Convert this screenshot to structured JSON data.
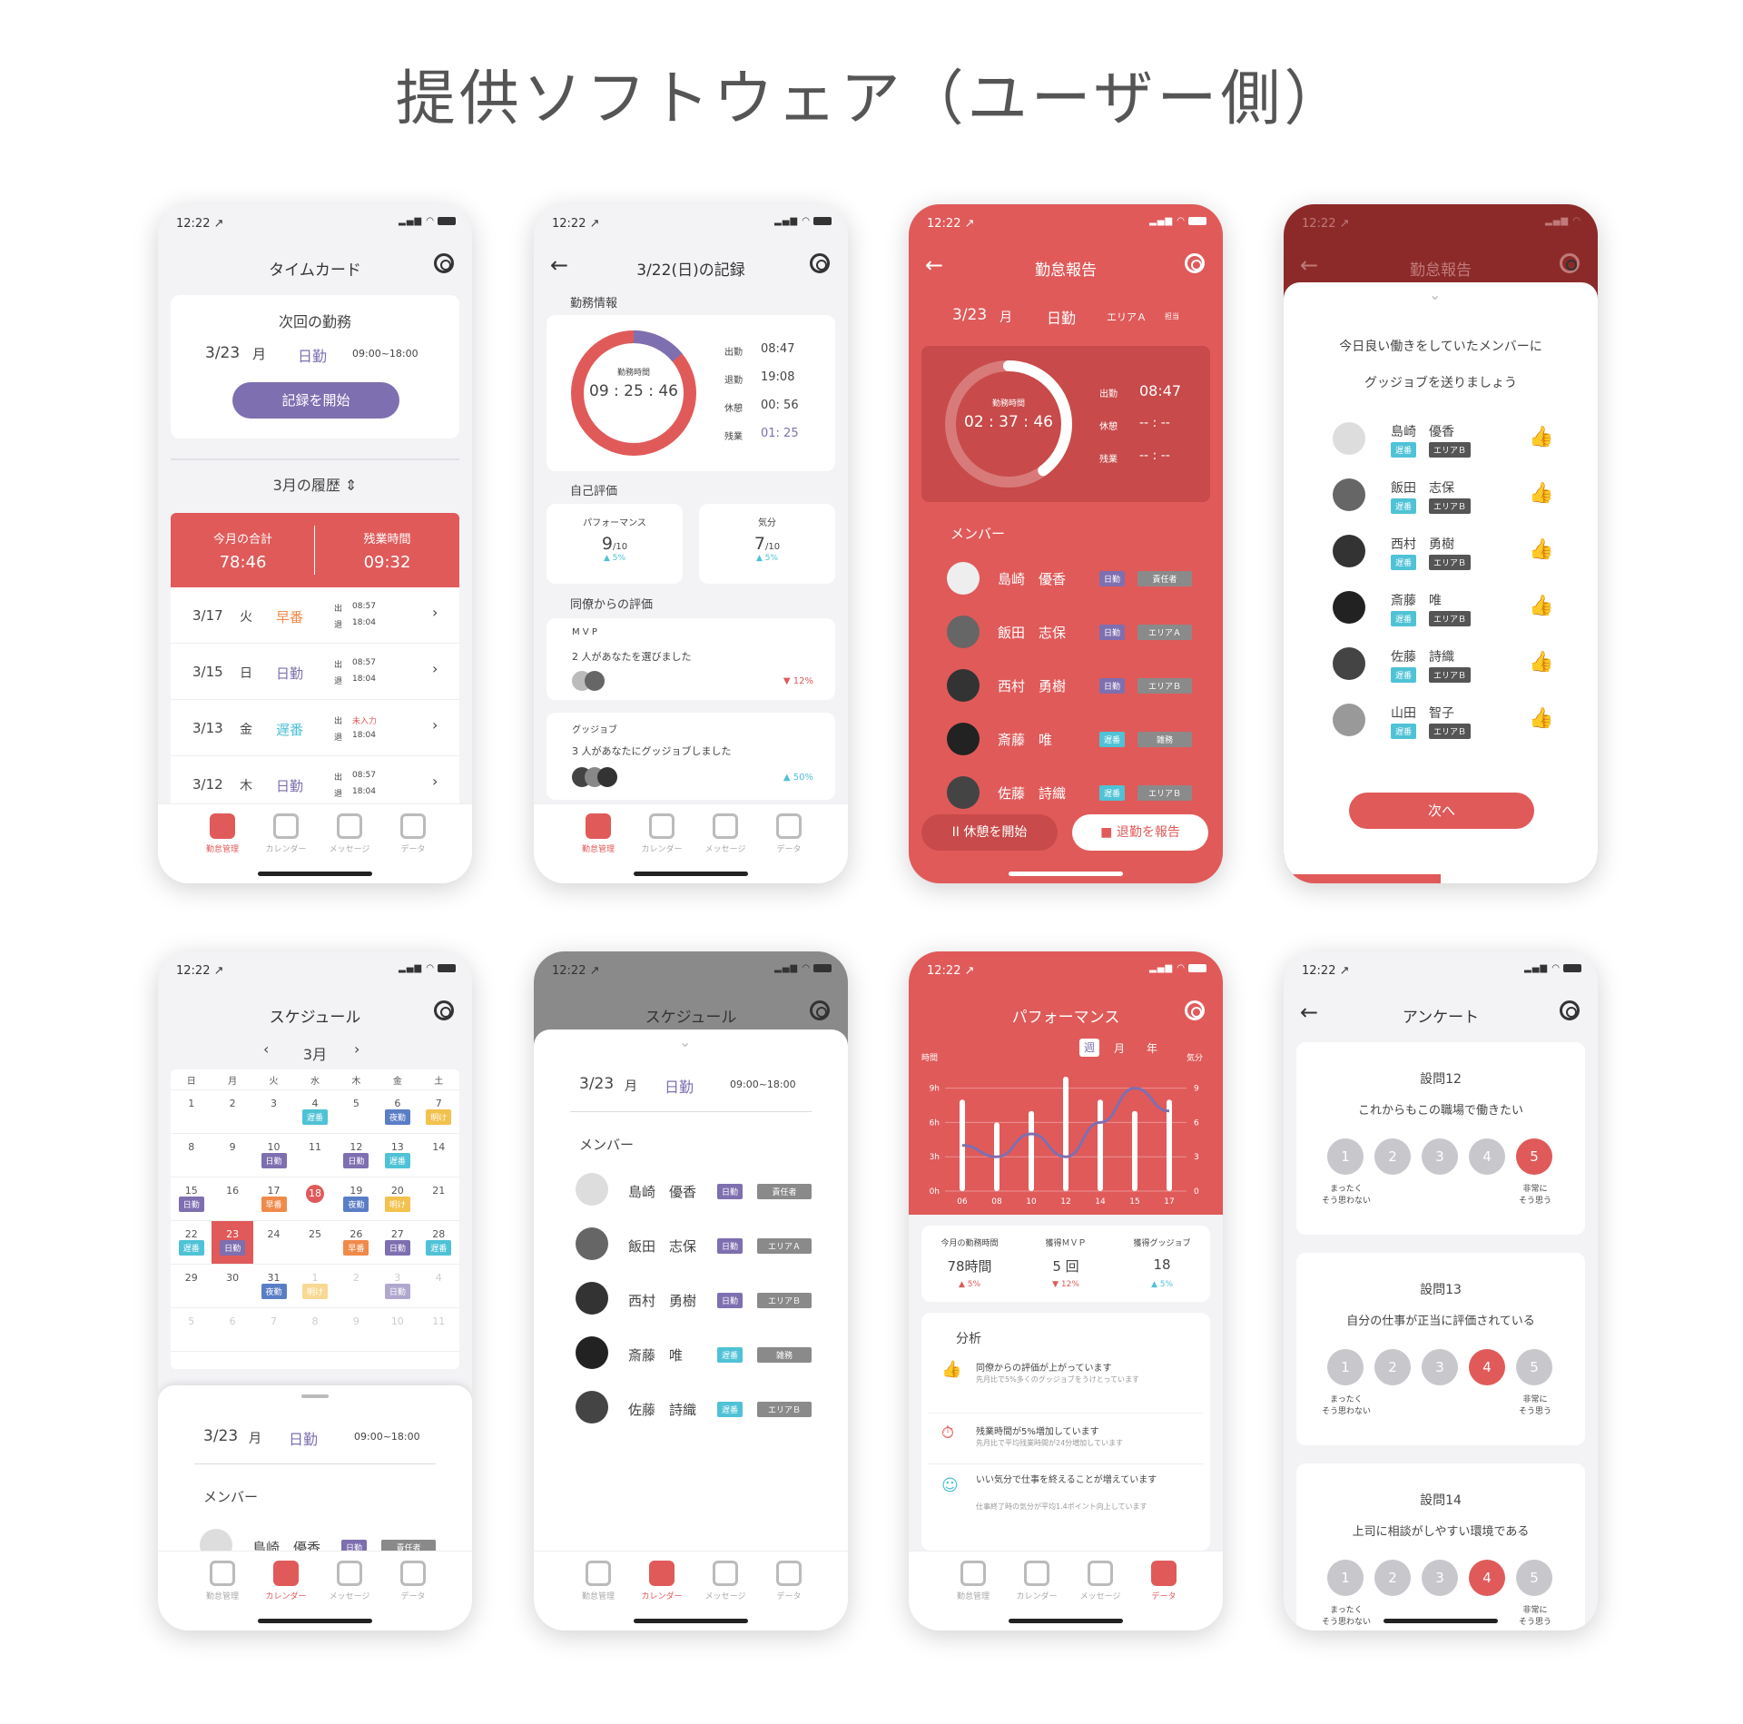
{
  "page_title": "提供ソフトウェア（ユーザー側）",
  "status": {
    "time": "12:22 ↗"
  },
  "tabs": [
    "勤怠管理",
    "カレンダー",
    "メッセージ",
    "データ"
  ],
  "s1": {
    "title": "タイムカード",
    "next_label": "次回の勤務",
    "next_date": "3/23",
    "next_dow": "月",
    "next_shift": "日勤",
    "next_time": "09:00~18:00",
    "start_btn": "記録を開始",
    "history": "3月の履歴 ⇕",
    "total_label": "今月の合計",
    "total": "78:46",
    "ot_label": "残業時間",
    "ot": "09:32",
    "rows": [
      {
        "date": "3/17",
        "dow": "火",
        "shift": "早番",
        "in": "08:57",
        "out": "18:04"
      },
      {
        "date": "3/15",
        "dow": "日",
        "shift": "日勤",
        "in": "08:57",
        "out": "18:04"
      },
      {
        "date": "3/13",
        "dow": "金",
        "shift": "遅番",
        "in": "未入力",
        "out": "18:04"
      },
      {
        "date": "3/12",
        "dow": "木",
        "shift": "日勤",
        "in": "08:57",
        "out": "18:04"
      }
    ],
    "in_label": "出",
    "out_label": "退"
  },
  "s2": {
    "title": "3/22(日)の記録",
    "work_info": "勤務情報",
    "ring_label": "勤務時間",
    "ring_value": "09 : 25 : 46",
    "stats": [
      [
        "出勤",
        "08:47"
      ],
      [
        "退勤",
        "19:08"
      ],
      [
        "休憩",
        "00: 56"
      ],
      [
        "残業",
        "01: 25"
      ]
    ],
    "self_eval": "自己評価",
    "perf_label": "パフォーマンス",
    "perf": "9",
    "perf_unit": "/10",
    "perf_delta": "▲ 5%",
    "mood_label": "気分",
    "mood": "7",
    "mood_unit": "/10",
    "mood_delta": "▲ 5%",
    "peer_eval": "同僚からの評価",
    "mvp_label": "M V P",
    "mvp_text": "2 人があなたを選びました",
    "mvp_delta": "▼ 12%",
    "gj_label": "グッジョブ",
    "gj_text": "3 人があなたにグッジョブしました",
    "gj_delta": "▲ 50%"
  },
  "s3": {
    "title": "勤怠報告",
    "date": "3/23",
    "dow": "月",
    "shift": "日勤",
    "area": "エリアＡ",
    "role": "担当",
    "ring_label": "勤務時間",
    "ring_value": "02 : 37 : 46",
    "stats": [
      [
        "出勤",
        "08:47"
      ],
      [
        "休憩",
        "-- : --"
      ],
      [
        "残業",
        "-- : --"
      ]
    ],
    "members_label": "メンバー",
    "members": [
      {
        "name": "島崎　優香",
        "shift": "日勤",
        "tag": "責任者"
      },
      {
        "name": "飯田　志保",
        "shift": "日勤",
        "tag": "エリアＡ"
      },
      {
        "name": "西村　勇樹",
        "shift": "日勤",
        "tag": "エリアＢ"
      },
      {
        "name": "斎藤　唯",
        "shift": "遅番",
        "tag": "雑務"
      },
      {
        "name": "佐藤　詩織",
        "shift": "遅番",
        "tag": "エリアＢ"
      }
    ],
    "break_btn": "II  休憩を開始",
    "leave_btn": "■  退勤を報告"
  },
  "s4": {
    "title": "勤怠報告",
    "line1": "今日良い働きをしていたメンバーに",
    "line2": "グッジョブを送りましょう",
    "members": [
      {
        "name": "島崎　優香",
        "shift": "遅番",
        "area": "エリアＢ",
        "liked": true
      },
      {
        "name": "飯田　志保",
        "shift": "遅番",
        "area": "エリアＢ",
        "liked": true
      },
      {
        "name": "西村　勇樹",
        "shift": "遅番",
        "area": "エリアＢ",
        "liked": false
      },
      {
        "name": "斎藤　唯",
        "shift": "遅番",
        "area": "エリアＢ",
        "liked": false
      },
      {
        "name": "佐藤　詩織",
        "shift": "遅番",
        "area": "エリアＢ",
        "liked": true
      },
      {
        "name": "山田　智子",
        "shift": "遅番",
        "area": "エリアＢ",
        "liked": false
      }
    ],
    "next_btn": "次へ"
  },
  "s5": {
    "title": "スケジュール",
    "month": "3月",
    "dows": [
      "日",
      "月",
      "火",
      "水",
      "木",
      "金",
      "土"
    ],
    "sheet_date": "3/23",
    "sheet_dow": "月",
    "sheet_shift": "日勤",
    "sheet_time": "09:00~18:00",
    "members_label": "メンバー",
    "first_member": "島崎　優香",
    "first_shift": "日勤",
    "first_tag": "責任者"
  },
  "s6": {
    "title": "スケジュール",
    "date": "3/23",
    "dow": "月",
    "shift": "日勤",
    "time": "09:00~18:00",
    "members_label": "メンバー",
    "members": [
      {
        "name": "島崎　優香",
        "shift": "日勤",
        "tag": "責任者"
      },
      {
        "name": "飯田　志保",
        "shift": "日勤",
        "tag": "エリアＡ"
      },
      {
        "name": "西村　勇樹",
        "shift": "日勤",
        "tag": "エリアＢ"
      },
      {
        "name": "斎藤　唯",
        "shift": "遅番",
        "tag": "雑務"
      },
      {
        "name": "佐藤　詩織",
        "shift": "遅番",
        "tag": "エリアＢ"
      }
    ]
  },
  "s7": {
    "title": "パフォーマンス",
    "periods": [
      "週",
      "月",
      "年"
    ],
    "y_left_label": "時間",
    "y_right_label": "気分",
    "kpi": [
      {
        "label": "今月の勤務時間",
        "value": "78時間",
        "delta": "▲ 5%"
      },
      {
        "label": "獲得ＭＶＰ",
        "value": "5 回",
        "delta": "▼ 12%"
      },
      {
        "label": "獲得グッジョブ",
        "value": "18",
        "delta": "▲ 5%"
      }
    ],
    "analysis_title": "分析",
    "analysis": [
      {
        "head": "同僚からの評価が上がっています",
        "body": "先月比で5%多くのグッジョブをうけとっています"
      },
      {
        "head": "残業時間が5%増加しています",
        "body": "先月比で平均残業時間が24分増加しています"
      },
      {
        "head": "いい気分で仕事を終えることが増えています",
        "body": "仕事終了時の気分が平均1.4ポイント向上しています"
      }
    ]
  },
  "chart_data": {
    "type": "bar",
    "categories": [
      "06",
      "08",
      "10",
      "12",
      "14",
      "15",
      "17"
    ],
    "series": [
      {
        "values": [
          8,
          6,
          7,
          10,
          8,
          7,
          8
        ]
      },
      {
        "values": [
          4,
          3,
          5,
          3,
          6,
          9,
          7
        ]
      }
    ],
    "ylabel": "時間",
    "y_left_ticks": [
      "0h",
      "3h",
      "6h",
      "9h"
    ],
    "y_right_ticks": [
      "0",
      "3",
      "6",
      "9"
    ],
    "ylim": [
      0,
      10
    ],
    "bar_color": "#ffffff",
    "line_color": "#7e6fb0"
  },
  "s8": {
    "title": "アンケート",
    "questions": [
      {
        "no": "設問12",
        "text": "これからもこの職場で働きたい",
        "selected": 5
      },
      {
        "no": "設問13",
        "text": "自分の仕事が正当に評価されている",
        "selected": 4
      },
      {
        "no": "設問14",
        "text": "上司に相談がしやすい環境である",
        "selected": 4
      }
    ],
    "low_label": "まったく\nそう思わない",
    "high_label": "非常に\nそう思う"
  },
  "colors": {
    "accent": "#e05a5a",
    "purple": "#7e6fb0",
    "dark_red": "#8c2a2a"
  }
}
